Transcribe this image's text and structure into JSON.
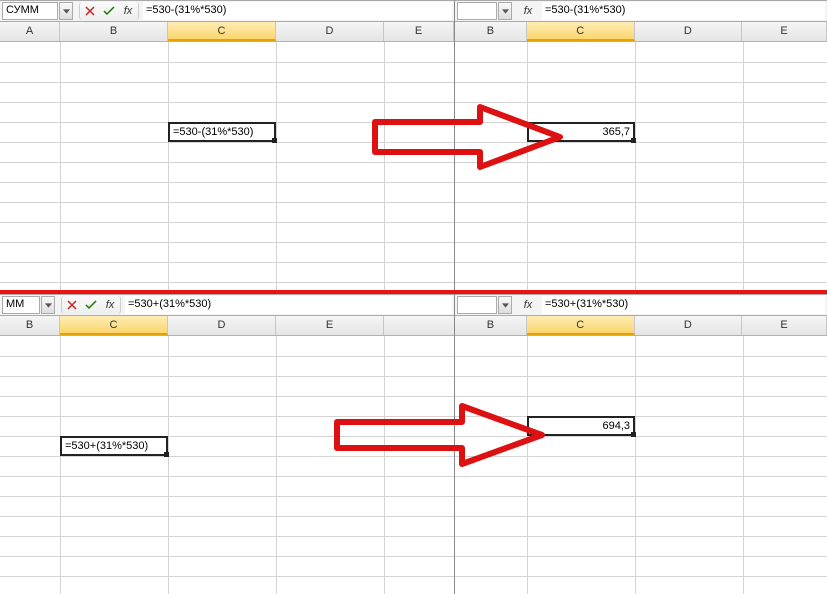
{
  "panels": {
    "tl": {
      "name_box": "СУММ",
      "formula": "=530-(31%*530)",
      "cell_display": "=530-(31%*530)",
      "columns": [
        "A",
        "B",
        "C",
        "D",
        "E"
      ],
      "active_col": "C"
    },
    "tr": {
      "name_box": "",
      "formula": "=530-(31%*530)",
      "cell_display": "365,7",
      "columns": [
        "B",
        "C",
        "D",
        "E"
      ],
      "active_col": "C"
    },
    "bl": {
      "name_box": "ММ",
      "formula": "=530+(31%*530)",
      "cell_display": "=530+(31%*530)",
      "columns": [
        "B",
        "C",
        "D",
        "E"
      ],
      "active_col": "C"
    },
    "br": {
      "name_box": "",
      "formula": "=530+(31%*530)",
      "cell_display": "694,3",
      "columns": [
        "B",
        "C",
        "D",
        "E"
      ],
      "active_col": "C"
    }
  },
  "fx_label": "fx",
  "icons": {
    "cancel": "×",
    "accept": "✓"
  }
}
